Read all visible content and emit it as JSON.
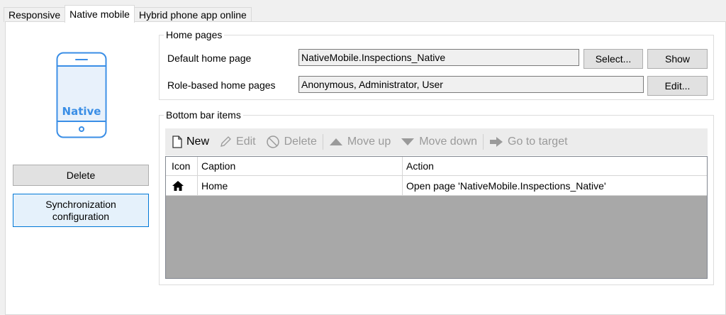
{
  "tabs": [
    {
      "label": "Responsive"
    },
    {
      "label": "Native mobile"
    },
    {
      "label": "Hybrid phone app online"
    }
  ],
  "left": {
    "phone_label": "Native",
    "delete_label": "Delete",
    "sync_label": "Synchronization configuration"
  },
  "home_pages": {
    "title": "Home pages",
    "default_label": "Default home page",
    "default_value": "NativeMobile.Inspections_Native",
    "select_label": "Select...",
    "show_label": "Show",
    "role_label": "Role-based home pages",
    "role_value": "Anonymous, Administrator, User",
    "edit_label": "Edit..."
  },
  "bottom_bar": {
    "title": "Bottom bar items",
    "toolbar": {
      "new": "New",
      "edit": "Edit",
      "delete": "Delete",
      "move_up": "Move up",
      "move_down": "Move down",
      "go_to_target": "Go to target"
    },
    "columns": {
      "icon": "Icon",
      "caption": "Caption",
      "action": "Action"
    },
    "rows": [
      {
        "icon": "home-icon",
        "caption": "Home",
        "action": "Open page 'NativeMobile.Inspections_Native'"
      }
    ]
  },
  "colors": {
    "accent": "#0078d7",
    "phone": "#3a8ee6"
  }
}
